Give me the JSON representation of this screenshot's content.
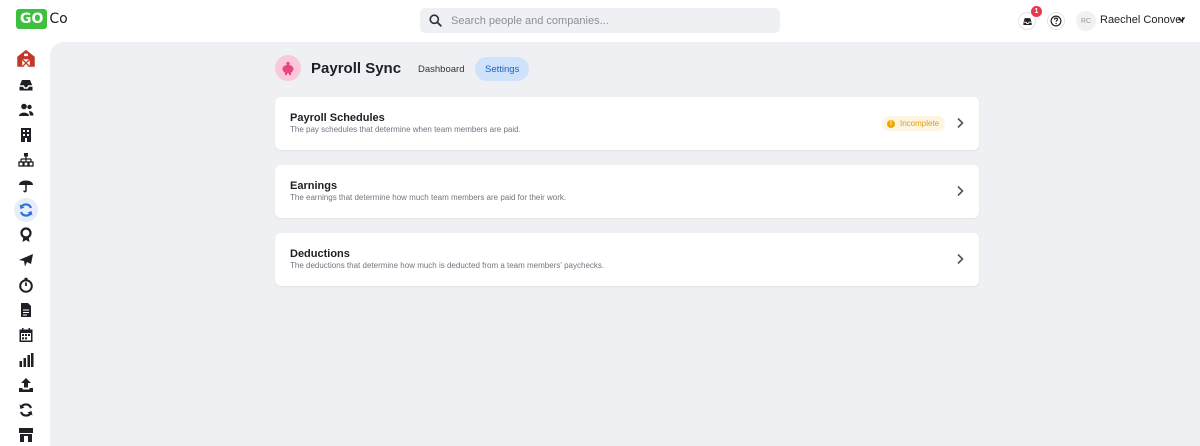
{
  "brand": {
    "logo_go": "GO",
    "logo_co": "Co",
    "accent_color": "#3fbf3f"
  },
  "search": {
    "placeholder": "Search people and companies..."
  },
  "header": {
    "notification_count": "1",
    "avatar_initials": "RC",
    "user_name": "Raechel Conover",
    "icons": [
      "inbox-icon",
      "help-icon",
      "chevron-down-icon"
    ]
  },
  "sidebar": {
    "items": [
      {
        "name": "home",
        "icon": "barn-icon"
      },
      {
        "name": "inbox",
        "icon": "inbox-icon"
      },
      {
        "name": "people",
        "icon": "people-icon"
      },
      {
        "name": "company",
        "icon": "building-icon"
      },
      {
        "name": "org-chart",
        "icon": "org-chart-icon"
      },
      {
        "name": "benefits",
        "icon": "umbrella-icon"
      },
      {
        "name": "payroll-sync",
        "icon": "sync-icon",
        "active": true
      },
      {
        "name": "recognition",
        "icon": "award-icon"
      },
      {
        "name": "time-off",
        "icon": "plane-icon"
      },
      {
        "name": "time-tracking",
        "icon": "stopwatch-icon"
      },
      {
        "name": "documents",
        "icon": "document-icon"
      },
      {
        "name": "calendar",
        "icon": "calendar-icon"
      },
      {
        "name": "reports",
        "icon": "bar-chart-icon"
      },
      {
        "name": "upload",
        "icon": "upload-icon"
      },
      {
        "name": "workflows",
        "icon": "refresh-icon"
      },
      {
        "name": "marketplace",
        "icon": "store-icon"
      }
    ]
  },
  "page": {
    "title": "Payroll Sync",
    "icon": "piggy-bank-icon",
    "tabs": [
      {
        "label": "Dashboard",
        "active": false
      },
      {
        "label": "Settings",
        "active": true
      }
    ]
  },
  "cards": [
    {
      "title": "Payroll Schedules",
      "description": "The pay schedules that determine when team members are paid.",
      "status": "Incomplete",
      "status_color": "#e3a000"
    },
    {
      "title": "Earnings",
      "description": "The earnings that determine how much team members are paid for their work."
    },
    {
      "title": "Deductions",
      "description": "The deductions that determine how much is deducted from a team members' paychecks."
    }
  ]
}
